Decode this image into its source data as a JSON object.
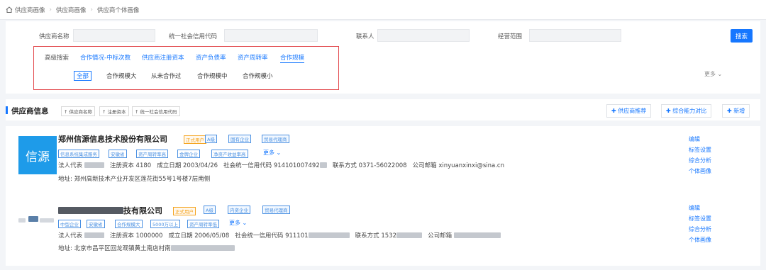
{
  "breadcrumb": [
    "供应商画像",
    "供应商画像",
    "供应商个体画像"
  ],
  "search": {
    "supplier_name_label": "供应商名称",
    "credit_code_label": "统一社会信用代码",
    "contact_label": "联系人",
    "business_scope_label": "经营范围",
    "search_button": "搜索"
  },
  "advanced": {
    "label": "高级搜索",
    "tabs": [
      "合作情况-中标次数",
      "供应商注册资本",
      "资产负债率",
      "资产周转率",
      "合作规模"
    ],
    "options": [
      "全部",
      "合作规模大",
      "从未合作过",
      "合作规模中",
      "合作规模小"
    ],
    "more": "更多"
  },
  "info_bar": {
    "title": "供应商信息",
    "sorts": [
      "供应商名称",
      "注册资本",
      "统一社会信用代码"
    ],
    "actions": [
      "供应商推荐",
      "综合能力对比",
      "新增"
    ]
  },
  "cards": [
    {
      "logo_text": "信源",
      "name": "郑州信源信息技术股份有限公司",
      "status": "正式用户",
      "tags": [
        "A级",
        "国有企业",
        "贸易代理商"
      ],
      "labels": [
        "信息系统集成服务",
        "安徽省",
        "资产周转率高",
        "金牌企业",
        "净资产收益率高"
      ],
      "more": "更多",
      "legal_rep_label": "法人代表",
      "reg_capital_label": "注册资本",
      "reg_capital": "4180",
      "found_date_label": "成立日期",
      "found_date": "2003/04/26",
      "credit_label": "社会统一信用代码",
      "credit_code": "914101007492",
      "phone_label": "联系方式",
      "phone": "0371-56022008",
      "email_label": "公司邮箱",
      "email": "xinyuanxinxi@sina.cn",
      "address_label": "地址:",
      "address": "郑州高新技术产业开发区莲花街55号1号楼7层南侧",
      "links": [
        "编辑",
        "标签设置",
        "综合分析",
        "个体画像"
      ]
    },
    {
      "name_suffix": "技有限公司",
      "status": "正式用户",
      "tags": [
        "A级",
        "内资企业",
        "贸易代理商"
      ],
      "labels": [
        "中型企业",
        "安徽省",
        "合作规模大",
        "5000万以上",
        "资产周转率低"
      ],
      "more": "更多",
      "legal_rep_label": "法人代表",
      "reg_capital_label": "注册资本",
      "reg_capital": "1000000",
      "found_date_label": "成立日期",
      "found_date": "2006/05/08",
      "credit_label": "社会统一信用代码",
      "credit_code": "911101",
      "phone_label": "联系方式",
      "phone": "1532",
      "email_label": "公司邮箱",
      "address_label": "地址:",
      "address": "北京市昌平区回龙观镇黄土南店村南",
      "links": [
        "编辑",
        "标签设置",
        "综合分析",
        "个体画像"
      ]
    }
  ],
  "colors": {
    "accent": "#1677ff",
    "logo_bg": "#1e9be9",
    "highlight_border": "#e2474b",
    "status_tag": "#f5a623"
  }
}
